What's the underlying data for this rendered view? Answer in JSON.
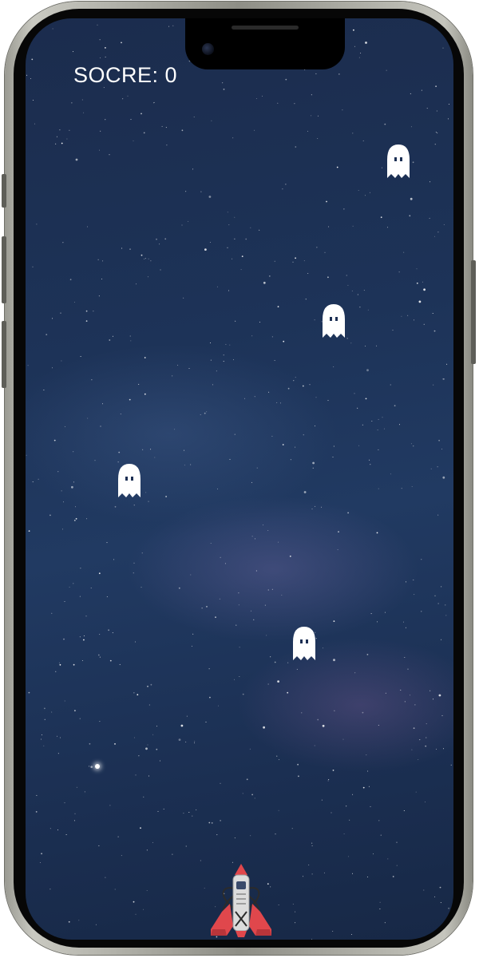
{
  "hud": {
    "score_text": "SOCRE: 0"
  },
  "entities": {
    "enemies": [
      {
        "kind": "ghost",
        "icon": "ghost-icon"
      },
      {
        "kind": "ghost",
        "icon": "ghost-icon"
      },
      {
        "kind": "ghost",
        "icon": "ghost-icon"
      },
      {
        "kind": "ghost",
        "icon": "ghost-icon"
      }
    ],
    "player": {
      "kind": "rocket-ship",
      "icon": "rocket-icon"
    }
  },
  "colors": {
    "sky_top": "#1b2c4d",
    "sky_mid": "#213a62",
    "ghost": "#ffffff",
    "ship_body": "#d9d9d9",
    "ship_accent": "#e0474c"
  }
}
